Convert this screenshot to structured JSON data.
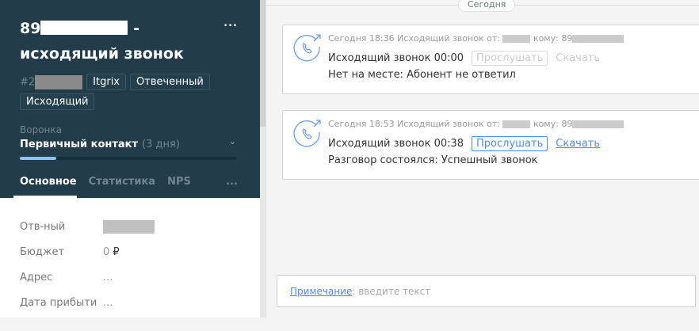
{
  "lead": {
    "title_prefix": "89",
    "title_suffix": "-",
    "title_line2": "исходящий звонок",
    "menu": "...",
    "id_prefix": "#2",
    "tags": [
      "Itgrix",
      "Отвеченный",
      "Исходящий"
    ],
    "funnel_label": "Воронка",
    "stage": "Первичный контакт",
    "stage_age": "(3 дня)",
    "progress": 0.17,
    "tabs": [
      "Основное",
      "Статистика",
      "NPS"
    ],
    "tabs_more": "...",
    "fields": [
      {
        "label": "Отв-ный",
        "value": ""
      },
      {
        "label": "Бюджет",
        "value": "0",
        "currency": "₽"
      },
      {
        "label": "Адрес",
        "value": "..."
      },
      {
        "label": "Дата прибыти",
        "value": "..."
      }
    ]
  },
  "feed": {
    "date_label": "Сегодня",
    "calls": [
      {
        "meta_a": "Сегодня 18:36 Исходящий звонок от:",
        "meta_b": "кому: 89",
        "title": "Исходящий звонок 00:00",
        "listen": "Прослушать",
        "download": "Скачать",
        "result": "Нет на месте: Абонент не ответил",
        "active": false
      },
      {
        "meta_a": "Сегодня 18:53 Исходящий звонок от:",
        "meta_b": "кому: 89",
        "title": "Исходящий звонок 00:38",
        "listen": "Прослушать",
        "download": "Скачать",
        "result": "Разговор состоялся: Успешный звонок",
        "active": true
      }
    ],
    "note_link": "Примечание",
    "note_placeholder": ": введите текст"
  },
  "colors": {
    "header": "#223c4a",
    "accent": "#4c8bf5"
  }
}
